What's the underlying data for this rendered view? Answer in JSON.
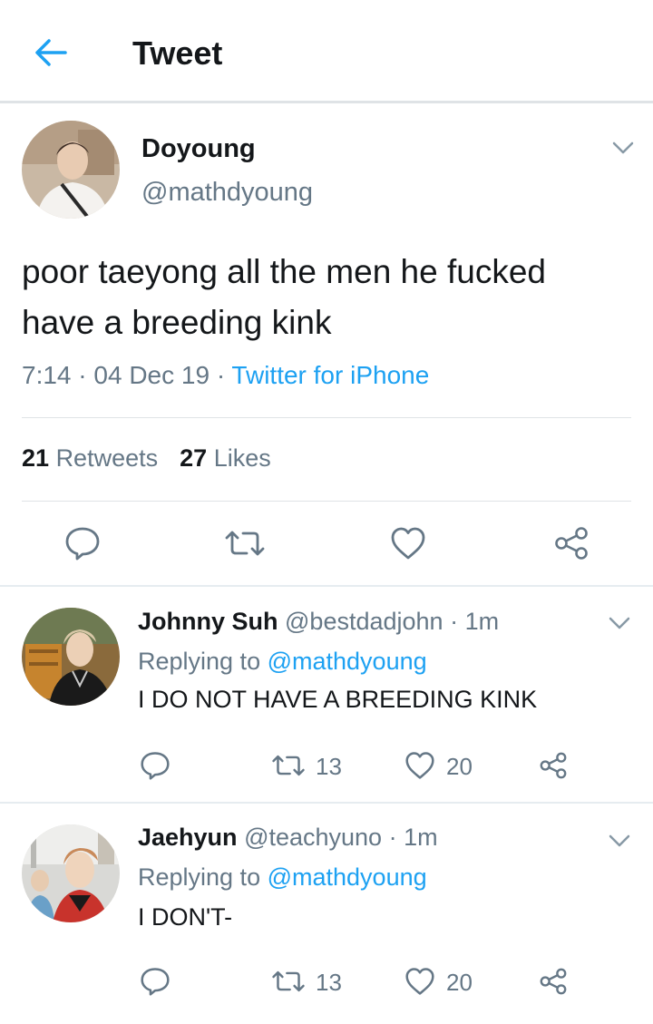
{
  "header": {
    "title": "Tweet",
    "back_icon": "arrow-left-icon"
  },
  "tweet": {
    "author_name": "Doyoung",
    "author_handle": "@mathdyoung",
    "text": "poor taeyong all the men he fucked have a breeding kink",
    "time": "7:14",
    "date": "04 Dec 19",
    "sep": "·",
    "source": "Twitter for iPhone",
    "retweets_count": "21",
    "retweets_label": "Retweets",
    "likes_count": "27",
    "likes_label": "Likes"
  },
  "replies": [
    {
      "name": "Johnny Suh",
      "handle": "@bestdadjohn",
      "sep": "·",
      "time": "1m",
      "replying_prefix": "Replying to",
      "replying_handle": "@mathdyoung",
      "text": "I DO NOT HAVE A BREEDING KINK",
      "retweets": "13",
      "likes": "20"
    },
    {
      "name": "Jaehyun",
      "handle": "@teachyuno",
      "sep": "·",
      "time": "1m",
      "replying_prefix": "Replying to",
      "replying_handle": "@mathdyoung",
      "text": "I DON'T-",
      "retweets": "13",
      "likes": "20"
    }
  ],
  "colors": {
    "accent": "#1da1f2",
    "text": "#14171a",
    "muted": "#657786",
    "divider": "#e6ecf0"
  }
}
